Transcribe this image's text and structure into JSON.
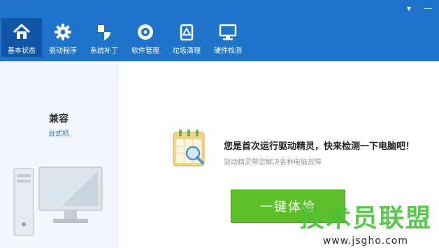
{
  "window_controls": {
    "menu": "▾",
    "minimize": "—"
  },
  "nav": {
    "items": [
      {
        "label": "基本状态",
        "icon": "home-icon"
      },
      {
        "label": "驱动程序",
        "icon": "gear-icon"
      },
      {
        "label": "系统补丁",
        "icon": "shield-icon"
      },
      {
        "label": "软件管理",
        "icon": "disc-icon"
      },
      {
        "label": "垃圾清理",
        "icon": "recycle-icon"
      },
      {
        "label": "硬件检测",
        "icon": "monitor-icon"
      }
    ],
    "active_index": 0
  },
  "left_panel": {
    "title": "兼容",
    "subtitle": "台式机"
  },
  "main": {
    "headline": "您是首次运行驱动精灵，快来检测一下电脑吧！",
    "subline": "驱动精灵帮您解决各种电脑故障",
    "button_label": "一键体检"
  },
  "watermark": {
    "text": "技术员联盟",
    "url": "www.jsgho.com"
  },
  "colors": {
    "topbar": "#1f73c8",
    "active_tab": "#0f57a6",
    "button": "#5fbf2b",
    "watermark": "#49c23a"
  }
}
